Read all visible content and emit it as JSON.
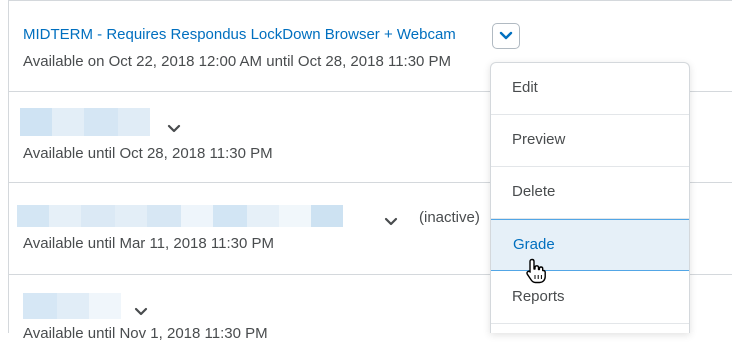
{
  "quizzes": [
    {
      "title": "MIDTERM - Requires Respondus LockDown Browser + Webcam",
      "availability": "Available on Oct 22, 2018 12:00 AM until Oct 28, 2018 11:30 PM"
    },
    {
      "availability": "Available until Oct 28, 2018 11:30 PM"
    },
    {
      "status": "(inactive)",
      "availability": "Available until Mar 11, 2018 11:30 PM"
    },
    {
      "availability": "Available until Nov 1, 2018 11:30 PM"
    }
  ],
  "context_menu": {
    "items": [
      "Edit",
      "Preview",
      "Delete",
      "Grade",
      "Reports"
    ],
    "highlighted": "Grade"
  },
  "icons": {
    "dropdown": "chevron-down-icon",
    "cursor": "hand-pointer-icon"
  },
  "colors": {
    "link": "#006fbf",
    "text": "#494c4e",
    "highlight_bg": "#e6f0f8",
    "highlight_border": "#52a6e6",
    "divider": "#d4d8dc"
  }
}
